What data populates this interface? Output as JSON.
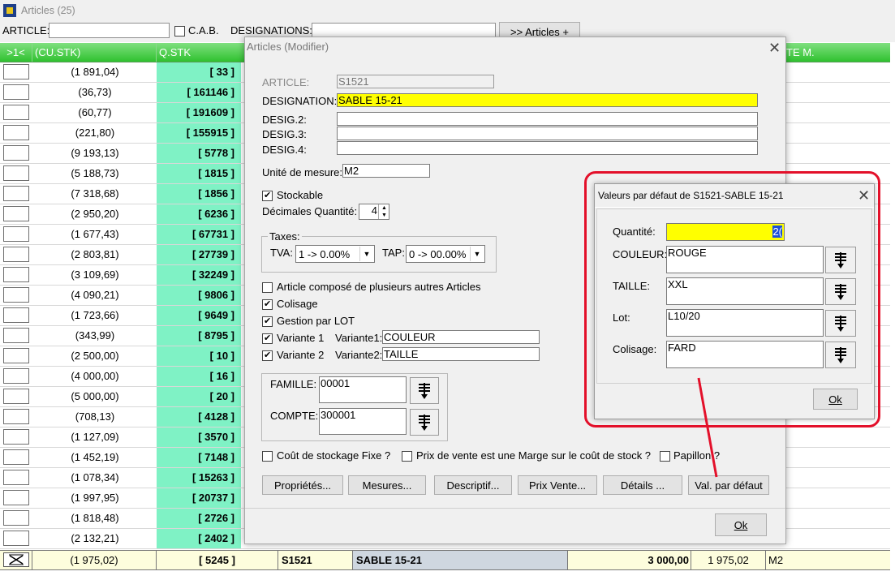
{
  "window": {
    "title": "Articles (25)"
  },
  "toolbar": {
    "article_label": "ARTICLE:",
    "cab_label": "C.A.B.",
    "designations_label": "DESIGNATIONS:",
    "articles_plus_button": ">> Articles +"
  },
  "grid": {
    "headers": {
      "sel": ">1<",
      "cu_stk": "(CU.STK)",
      "qstk": "Q.STK",
      "te_m": "TE M."
    },
    "rows": [
      {
        "cu": "(1 891,04)",
        "q": "[ 33 ]"
      },
      {
        "cu": "(36,73)",
        "q": "[ 161146 ]"
      },
      {
        "cu": "(60,77)",
        "q": "[ 191609 ]"
      },
      {
        "cu": "(221,80)",
        "q": "[ 155915 ]"
      },
      {
        "cu": "(9 193,13)",
        "q": "[ 5778 ]"
      },
      {
        "cu": "(5 188,73)",
        "q": "[ 1815 ]"
      },
      {
        "cu": "(7 318,68)",
        "q": "[ 1856 ]"
      },
      {
        "cu": "(2 950,20)",
        "q": "[ 6236 ]"
      },
      {
        "cu": "(1 677,43)",
        "q": "[ 67731 ]"
      },
      {
        "cu": "(2 803,81)",
        "q": "[ 27739 ]"
      },
      {
        "cu": "(3 109,69)",
        "q": "[ 32249 ]"
      },
      {
        "cu": "(4 090,21)",
        "q": "[ 9806 ]"
      },
      {
        "cu": "(1 723,66)",
        "q": "[ 9649 ]"
      },
      {
        "cu": "(343,99)",
        "q": "[ 8795 ]"
      },
      {
        "cu": "(2 500,00)",
        "q": "[ 10 ]"
      },
      {
        "cu": "(4 000,00)",
        "q": "[ 16 ]"
      },
      {
        "cu": "(5 000,00)",
        "q": "[ 20 ]"
      },
      {
        "cu": "(708,13)",
        "q": "[ 4128 ]"
      },
      {
        "cu": "(1 127,09)",
        "q": "[ 3570 ]"
      },
      {
        "cu": "(1 452,19)",
        "q": "[ 7148 ]"
      },
      {
        "cu": "(1 078,34)",
        "q": "[ 15263 ]"
      },
      {
        "cu": "(1 997,95)",
        "q": "[ 20737 ]"
      },
      {
        "cu": "(1 818,48)",
        "q": "[ 2726 ]"
      },
      {
        "cu": "(2 132,21)",
        "q": "[ 2402 ]"
      }
    ],
    "selected_row": {
      "cu": "(1 975,02)",
      "q": "[ 5245 ]",
      "code": "S1521",
      "designation": "SABLE 15-21",
      "price": "3 000,00",
      "cost": "1 975,02",
      "unit": "M2"
    }
  },
  "modify_dialog": {
    "title": "Articles  (Modifier)",
    "article_label": "ARTICLE:",
    "article_value": "S1521",
    "designation_label": "DESIGNATION:",
    "designation_value": "SABLE 15-21",
    "desig2_label": "DESIG.2:",
    "desig3_label": "DESIG.3:",
    "desig4_label": "DESIG.4:",
    "unit_label": "Unité de mesure:",
    "unit_value": "M2",
    "stockable_label": "Stockable",
    "decimals_label": "Décimales Quantité:",
    "decimals_value": "4",
    "taxes_label": "Taxes:",
    "tva_label": "TVA:",
    "tva_value": "1 ->  0.00%",
    "tap_label": "TAP:",
    "tap_value": "0 -> 00.00%",
    "compose_label": "Article composé de plusieurs autres Articles",
    "colisage_label": "Colisage",
    "lot_label": "Gestion par LOT",
    "variante1_label": "Variante 1",
    "variante1_field_label": "Variante1:",
    "variante1_value": "COULEUR",
    "variante2_label": "Variante 2",
    "variante2_field_label": "Variante2:",
    "variante2_value": "TAILLE",
    "famille_label": "FAMILLE:",
    "famille_value": "00001",
    "compte_label": "COMPTE:",
    "compte_value": "300001",
    "cout_fixe_label": "Coût de stockage Fixe ?",
    "prix_marge_label": "Prix de vente est une Marge sur le coût de stock ?",
    "papillon_label": "Papillon ?",
    "buttons": {
      "proprietes": "Propriétés...",
      "mesures": "Mesures...",
      "descriptif": "Descriptif...",
      "prix_vente": "Prix Vente...",
      "details": "Détails ...",
      "val_defaut": "Val. par défaut",
      "ok": "Ok"
    }
  },
  "defaults_dialog": {
    "title": "Valeurs par défaut de S1521-SABLE 15-21",
    "quantite_label": "Quantité:",
    "quantite_value": "2(",
    "couleur_label": "COULEUR:",
    "couleur_value": "ROUGE",
    "taille_label": "TAILLE:",
    "taille_value": "XXL",
    "lot_label": "Lot:",
    "lot_value": "L10/20",
    "colisage_label": "Colisage:",
    "colisage_value": "FARD",
    "ok": "Ok"
  },
  "colors": {
    "header_green": "#2fc12f",
    "qstk_bg": "#7ff2c5",
    "highlight_red": "#e3102a",
    "field_yellow": "#ffff00"
  }
}
